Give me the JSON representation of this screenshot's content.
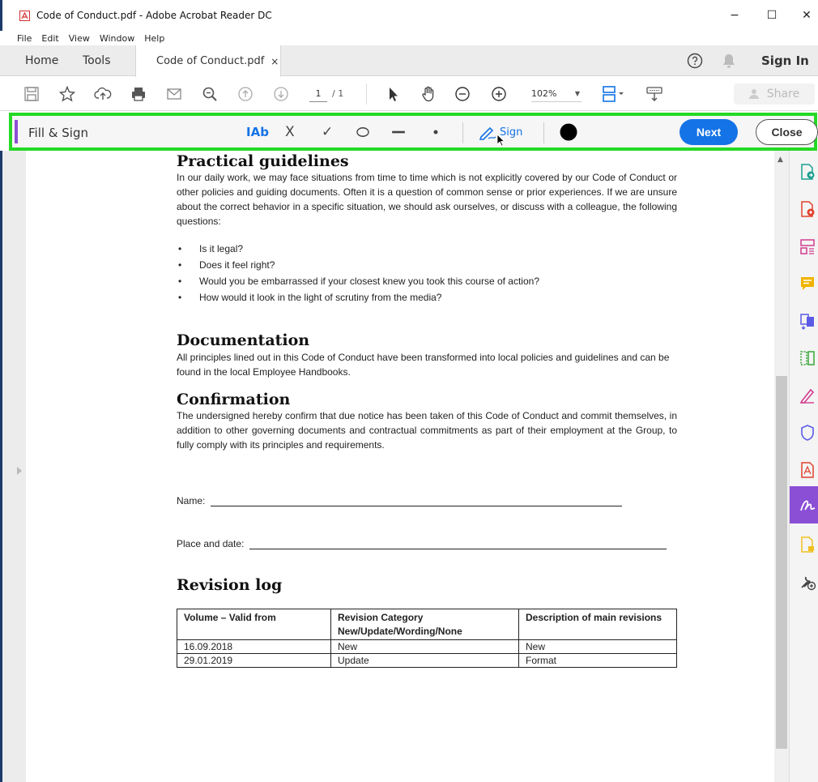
{
  "window": {
    "title": "Code of Conduct.pdf - Adobe Acrobat Reader DC",
    "minimize": "−",
    "maximize": "☐",
    "close": "✕"
  },
  "menu": [
    "File",
    "Edit",
    "View",
    "Window",
    "Help"
  ],
  "tabs": {
    "home": "Home",
    "tools": "Tools",
    "document": "Code of Conduct.pdf",
    "document_close": "×",
    "sign_in": "Sign In"
  },
  "toolbar": {
    "page_current": "1",
    "page_total": "/ 1",
    "zoom": "102%",
    "share": "Share"
  },
  "fill_sign": {
    "title": "Fill & Sign",
    "text_tool": "IAb",
    "cross_tool": "X",
    "check_tool": "✓",
    "sign_label": "Sign",
    "next_button": "Next",
    "close_button": "Close"
  },
  "document": {
    "practical": {
      "heading": "Practical guidelines",
      "intro": "In our daily work, we may face situations from time to time which is not explicitly covered by our Code of Conduct or other policies and guiding documents. Often it is a question of common sense or prior experiences. If we are unsure about the correct behavior in a specific situation, we should ask ourselves, or discuss with a colleague, the following questions:",
      "questions": [
        "Is it legal?",
        "Does it feel right?",
        "Would you be embarrassed if your closest knew you took this course of action?",
        "How would it look in the light of scrutiny from the media?"
      ]
    },
    "documentation": {
      "heading": "Documentation",
      "text": "All principles lined out in this Code of Conduct have been transformed into local policies and guidelines and can be found in the local Employee Handbooks."
    },
    "confirmation": {
      "heading": "Confirmation",
      "text": "The undersigned hereby confirm that due notice has been taken of this Code of Conduct and commit themselves, in addition to other governing documents and contractual commitments as part of their employment at the Group, to fully comply with its principles and requirements."
    },
    "fields": {
      "name_label": "Name:",
      "place_label": "Place and date:"
    },
    "revision": {
      "heading": "Revision log",
      "headers": [
        "Volume – Valid from",
        "Revision Category",
        "Description of main revisions"
      ],
      "header_sub": "New/Update/Wording/None",
      "rows": [
        [
          "16.09.2018",
          "New",
          "New"
        ],
        [
          "29.01.2019",
          "Update",
          "Format"
        ]
      ]
    }
  },
  "colors": {
    "highlight": "#25d925",
    "accent": "#1473e6",
    "fillsign_purple": "#8b4fd6"
  }
}
